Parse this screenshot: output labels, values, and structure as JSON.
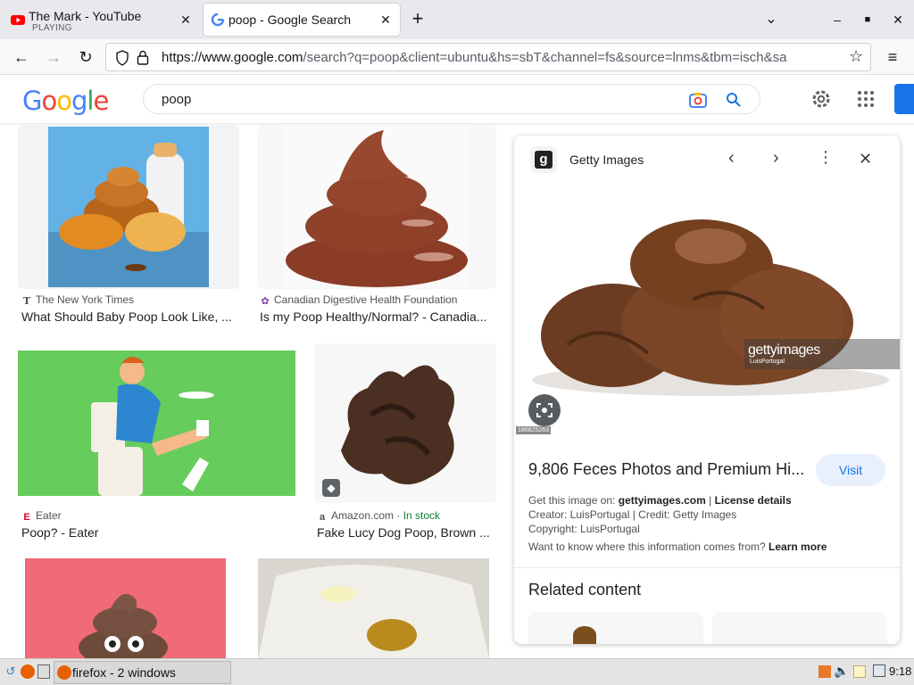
{
  "browser": {
    "tabs": [
      {
        "title": "The Mark - YouTube",
        "subtitle": "PLAYING",
        "favicon": "youtube-icon",
        "active": false
      },
      {
        "title": "poop - Google Search",
        "favicon": "google-g-icon",
        "active": true
      }
    ],
    "url_host": "https://www.google.com",
    "url_rest": "/search?q=poop&client=ubuntu&hs=sbT&channel=fs&source=lnms&tbm=isch&sa"
  },
  "google": {
    "logo": [
      "G",
      "o",
      "o",
      "g",
      "l",
      "e"
    ],
    "logo_colors": [
      "#4285F4",
      "#EA4335",
      "#FBBC05",
      "#4285F4",
      "#34A853",
      "#EA4335"
    ],
    "query": "poop"
  },
  "results": [
    {
      "source": "The New York Times",
      "caption": "What Should Baby Poop Look Like, ..."
    },
    {
      "source": "Canadian Digestive Health Foundation",
      "caption": "Is my Poop Healthy/Normal? - Canadia..."
    },
    {
      "source": "Eater",
      "caption": "Poop? - Eater"
    },
    {
      "source": "Amazon.com",
      "source_extra": "In stock",
      "caption": "Fake Lucy Dog Poop, Brown ..."
    }
  ],
  "panel": {
    "site": "Getty Images",
    "watermark": "gettyimages",
    "watermark_sub": "LuisPortugal",
    "image_id": "186825263",
    "title": "9,806 Feces Photos and Premium Hi...",
    "visit": "Visit",
    "get_image_label": "Get this image on:",
    "get_image_site": "gettyimages.com",
    "separator": "|",
    "license": "License details",
    "creator": "Creator: LuisPortugal | Credit: Getty Images",
    "copyright": "Copyright: LuisPortugal",
    "info_question": "Want to know where this information comes from?",
    "learn_more": "Learn more",
    "related": "Related content"
  },
  "taskbar": {
    "window_label": "firefox - 2 windows",
    "clock": "9:18"
  },
  "colors": {
    "accent": "#1a73e8",
    "visit_bg": "#e8f0fe"
  }
}
